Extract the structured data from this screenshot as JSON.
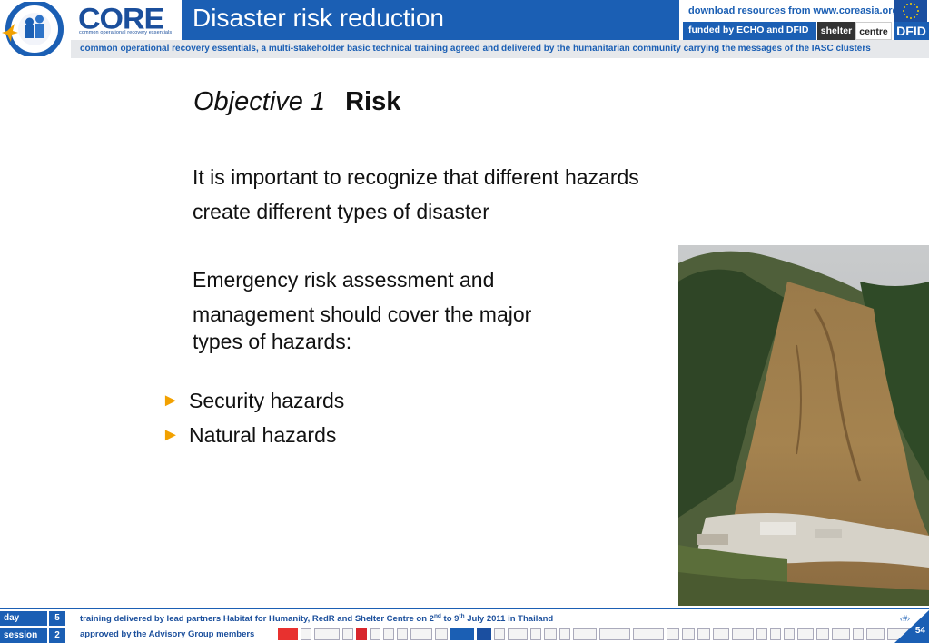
{
  "header": {
    "brand": "CORE",
    "brand_sub": "common operational recovery essentials",
    "title": "Disaster risk reduction",
    "download_text": "download resources from www.coreasia.org",
    "funded_text": "funded by ECHO and DFID",
    "shelter_label": "shelter",
    "centre_label": "centre",
    "dfid_label": "DFID",
    "tagline": "common operational recovery essentials, a multi-stakeholder basic technical training agreed and delivered by the humanitarian community carrying the messages of the IASC clusters"
  },
  "content": {
    "objective_label": "Objective 1",
    "objective_title": "Risk",
    "paragraph1_line1": "It is important to recognize that different hazards",
    "paragraph1_line2": "create different types of disaster",
    "paragraph2_line1": "Emergency risk assessment and",
    "paragraph2_line2": "management should cover the major",
    "paragraph2_line3": "types of hazards:",
    "bullets": [
      "Security hazards",
      "Natural hazards"
    ]
  },
  "footer": {
    "day_label": "day",
    "day_value": "5",
    "session_label": "session",
    "session_value": "2",
    "training_text_a": "training delivered by lead partners Habitat for Humanity, RedR and Shelter Centre on 2",
    "training_sup1": "nd",
    "training_text_b": " to 9",
    "training_sup2": "th",
    "training_text_c": " July 2011 in Thailand",
    "approved_text": "approved by the Advisory Group members",
    "page_number": "54"
  },
  "colors": {
    "primary_blue": "#1b5fb4",
    "bullet_orange": "#f2a100",
    "tagline_bg": "#e6e8eb"
  }
}
